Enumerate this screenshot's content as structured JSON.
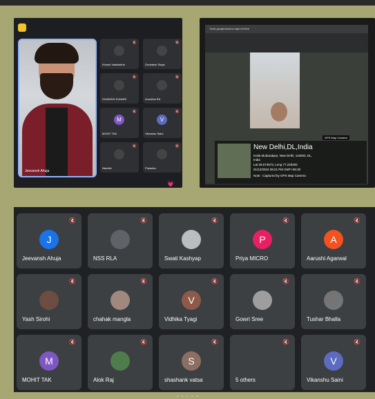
{
  "top_left": {
    "speaker_name": "Jeevansh Ahuja",
    "mini_tiles": [
      {
        "name": "Khushi Vashishtha",
        "avatar": "",
        "color": "#444"
      },
      {
        "name": "Gurbaksh Singh",
        "avatar": "",
        "color": "#444"
      },
      {
        "name": "DIVANSHI KUMARI",
        "avatar": "",
        "color": "#444"
      },
      {
        "name": "Anushka RA",
        "avatar": "",
        "color": "#444"
      },
      {
        "name": "MOHIT TAK",
        "avatar": "M",
        "color": "#7e57c2"
      },
      {
        "name": "Vikanshu Saini",
        "avatar": "V",
        "color": "#5c6bc0"
      },
      {
        "name": "Nandini",
        "avatar": "",
        "color": "#444"
      },
      {
        "name": "Priyanka",
        "avatar": "",
        "color": "#444"
      }
    ]
  },
  "top_right": {
    "url_text": "Tools google/photos sign in/drive",
    "city": "New Delhi,DL,India",
    "line1": "Kotla Mubarakpur, New Delhi, 110003, DL,",
    "line2": "India",
    "line3": "Lat 28.574573, Long 77.228292",
    "line4": "01/12/2024 08:21 PM GMT+05:30",
    "line5": "Note : Captured by GPS Map Camera",
    "logo": "GPS Map Camera"
  },
  "participants": [
    {
      "name": "Jeevansh Ahuja",
      "avatar": "J",
      "color": "#1a73e8"
    },
    {
      "name": "NSS RLA",
      "avatar": "",
      "color": "#5f6368"
    },
    {
      "name": "Swati Kashyap",
      "avatar": "",
      "color": "#bdbdbd"
    },
    {
      "name": "Priya MICRO",
      "avatar": "P",
      "color": "#e91e63"
    },
    {
      "name": "Aarushi Agarwal",
      "avatar": "A",
      "color": "#f4511e"
    },
    {
      "name": "Yash Sirohi",
      "avatar": "",
      "color": "#6d4c41"
    },
    {
      "name": "chahak mangla",
      "avatar": "",
      "color": "#a1887f"
    },
    {
      "name": "Vidhika Tyagi",
      "avatar": "V",
      "color": "#8d5a49"
    },
    {
      "name": "Gowri Sree",
      "avatar": "",
      "color": "#9e9e9e"
    },
    {
      "name": "Tushar Bhalla",
      "avatar": "",
      "color": "#757575"
    },
    {
      "name": "MOHIT TAK",
      "avatar": "M",
      "color": "#7e57c2"
    },
    {
      "name": "Alok Raj",
      "avatar": "",
      "color": "#4e7d4b"
    },
    {
      "name": "shashank vatsa",
      "avatar": "S",
      "color": "#8d6e63"
    },
    {
      "name": "5 others",
      "avatar": "",
      "color": "#3c4043"
    },
    {
      "name": "Vikanshu Saini",
      "avatar": "V",
      "color": "#5c6bc0"
    }
  ],
  "pager": "• • • • •"
}
